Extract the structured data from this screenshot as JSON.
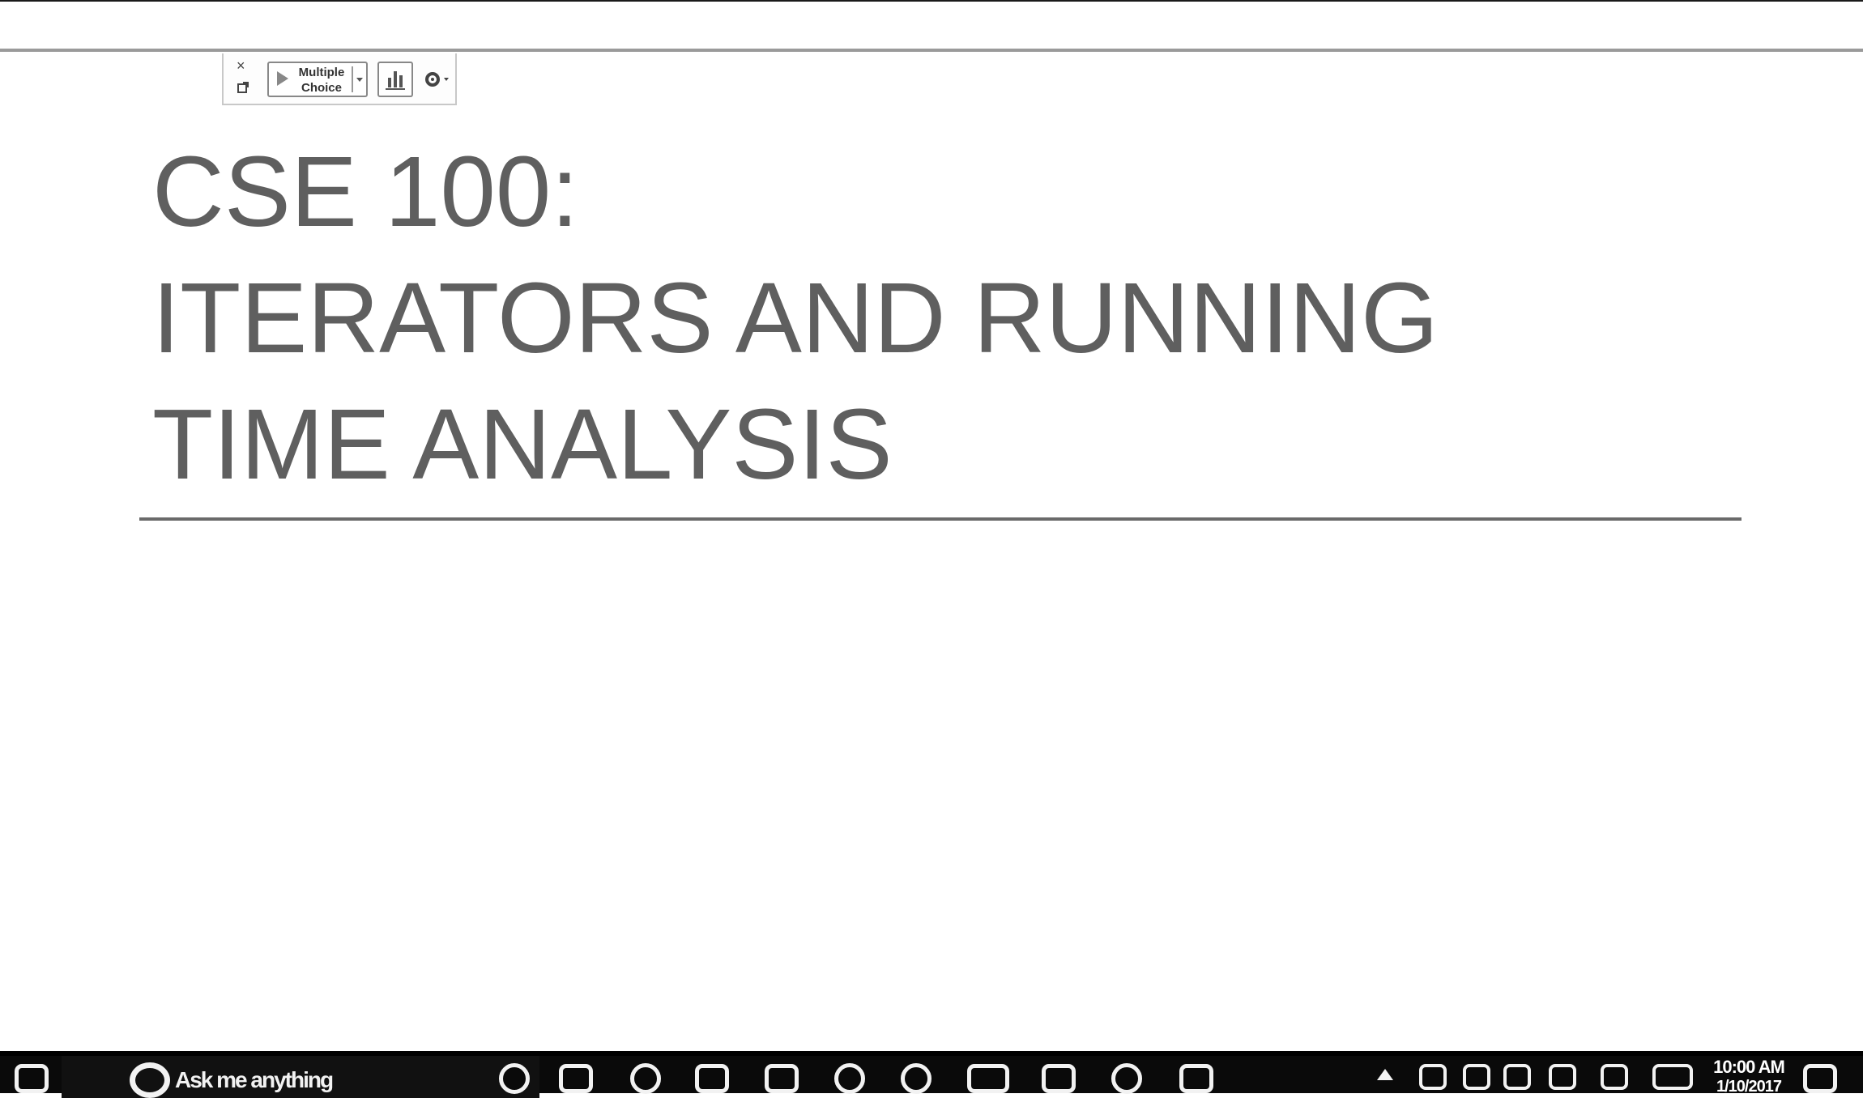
{
  "toolbar": {
    "close_glyph": "×",
    "poll_button_label_1": "Multiple",
    "poll_button_label_2": "Choice"
  },
  "slide": {
    "title_line_1": "CSE 100:",
    "title_line_2": "ITERATORS AND RUNNING",
    "title_line_3": "TIME ANALYSIS"
  },
  "taskbar": {
    "search_placeholder": "Ask me anything",
    "pinned_apps": [
      "edge-icon",
      "file-explorer-icon",
      "store-icon",
      "chrome-icon",
      "browser-icon",
      "mail-icon",
      "onenote-icon",
      "skype-icon",
      "app-icon"
    ],
    "clock_time": "10:00 AM",
    "clock_date": "1/10/2017"
  },
  "colors": {
    "title_text": "#5f5f5f",
    "taskbar_bg": "#0a0a0a",
    "taskbar_icon": "#f2f2f2"
  }
}
